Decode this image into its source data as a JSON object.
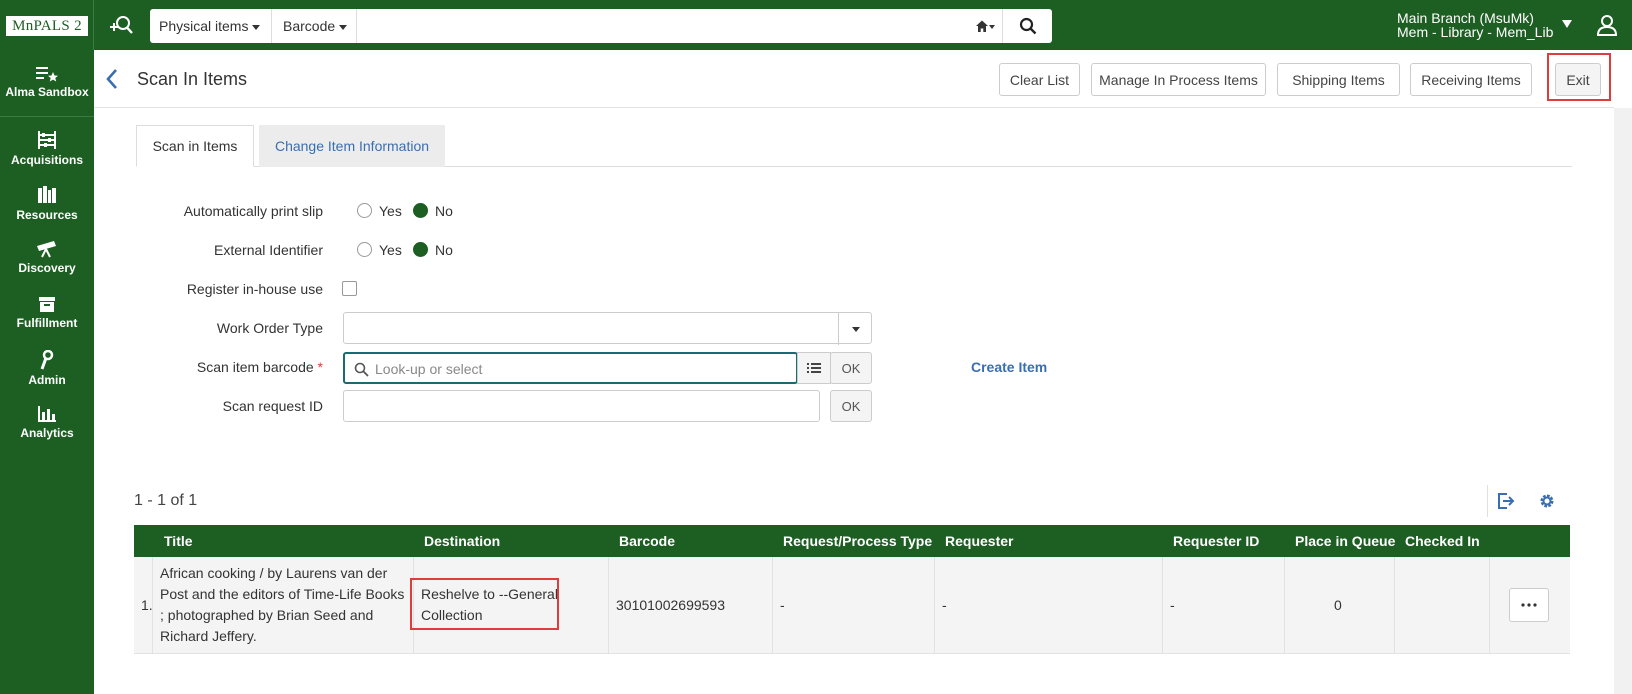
{
  "topbar": {
    "logo": "MnPALS 2",
    "search_type": "Physical items",
    "search_field": "Barcode",
    "search_value": "",
    "location_line1": "Main Branch (MsuMk)",
    "location_line2": "Mem - Library - Mem_Lib"
  },
  "sidebar": {
    "items": [
      {
        "label": "Alma Sandbox",
        "icon": "star-list-icon"
      },
      {
        "label": "Acquisitions",
        "icon": "abacus-icon"
      },
      {
        "label": "Resources",
        "icon": "books-icon"
      },
      {
        "label": "Discovery",
        "icon": "telescope-icon"
      },
      {
        "label": "Fulfillment",
        "icon": "box-icon"
      },
      {
        "label": "Admin",
        "icon": "wrench-icon"
      },
      {
        "label": "Analytics",
        "icon": "bar-chart-icon"
      }
    ]
  },
  "header": {
    "title": "Scan In Items",
    "buttons": {
      "clear_list": "Clear List",
      "manage": "Manage In Process Items",
      "shipping": "Shipping Items",
      "receiving": "Receiving Items",
      "exit": "Exit"
    }
  },
  "tabs": [
    {
      "label": "Scan in Items",
      "active": true
    },
    {
      "label": "Change Item Information",
      "active": false
    }
  ],
  "form": {
    "auto_print_label": "Automatically print slip",
    "auto_print_value": "No",
    "external_id_label": "External Identifier",
    "external_id_value": "No",
    "yes": "Yes",
    "no": "No",
    "register_label": "Register in-house use",
    "register_checked": false,
    "work_order_label": "Work Order Type",
    "work_order_value": "",
    "barcode_label": "Scan item barcode",
    "barcode_required": "*",
    "barcode_placeholder": "Look-up or select",
    "ok": "OK",
    "request_label": "Scan request ID",
    "request_value": "",
    "create_item": "Create Item"
  },
  "results": {
    "count": "1 - 1 of 1",
    "columns": [
      "Title",
      "Destination",
      "Barcode",
      "Request/Process Type",
      "Requester",
      "Requester ID",
      "Place in Queue",
      "Checked In"
    ],
    "rows": [
      {
        "num": "1.",
        "title": "African cooking / by Laurens van der Post and the editors of Time-Life Books ; photographed by Brian Seed and Richard Jeffery.",
        "destination": "Reshelve to --General Collection",
        "barcode": "30101002699593",
        "request_type": "-",
        "requester": "-",
        "requester_id": "-",
        "place_in_queue": "0",
        "checked_in": ""
      }
    ]
  },
  "colors": {
    "brand_green": "#1d5e23",
    "link_blue": "#3a6eb1",
    "highlight_red": "#e03c3c"
  }
}
